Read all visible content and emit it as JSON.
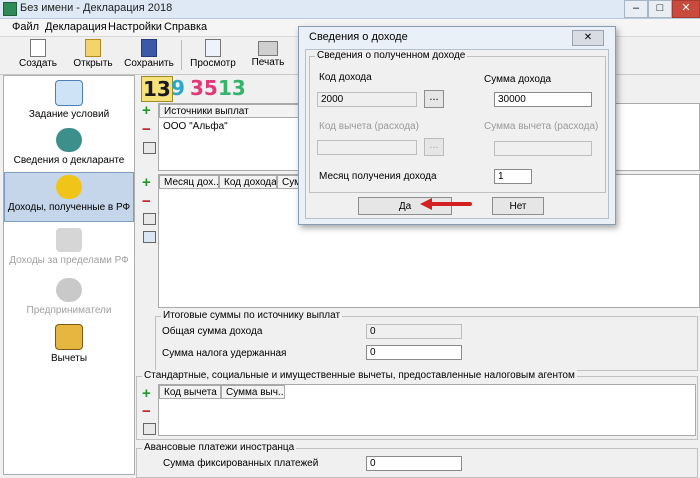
{
  "window": {
    "title": "Без имени - Декларация 2018",
    "min": "–",
    "max": "□",
    "close": "✕"
  },
  "menu": [
    "Файл",
    "Декларация",
    "Настройки",
    "Справка"
  ],
  "toolbar": {
    "create": "Создать",
    "open": "Открыть",
    "save": "Сохранить",
    "preview": "Просмотр",
    "print": "Печать"
  },
  "nav": [
    {
      "label": "Задание условий",
      "icon": "network-tree-icon"
    },
    {
      "label": "Сведения о декларанте",
      "icon": "person-icon"
    },
    {
      "label": "Доходы, полученные в РФ",
      "icon": "coins-icon"
    },
    {
      "label": "Доходы за пределами РФ",
      "icon": "money-bag-icon"
    },
    {
      "label": "Предприниматели",
      "icon": "businessman-icon"
    },
    {
      "label": "Вычеты",
      "icon": "deductions-icon"
    }
  ],
  "rates": [
    "13",
    "9",
    "35",
    "13"
  ],
  "sources": {
    "header": "Источники выплат",
    "rows": [
      "ООО \"Альфа\""
    ]
  },
  "income_table": {
    "headers": [
      "Месяц дох...",
      "Код дохода",
      "Сум"
    ]
  },
  "totals": {
    "title": "Итоговые суммы по источнику выплат",
    "income_label": "Общая сумма дохода",
    "income_value": "0",
    "tax_label": "Сумма налога удержанная",
    "tax_value": "0"
  },
  "deductions": {
    "title": "Стандартные, социальные и имущественные вычеты, предоставленные налоговым агентом",
    "headers": [
      "Код вычета",
      "Сумма выч..."
    ]
  },
  "advance": {
    "title": "Авансовые платежи иностранца",
    "label": "Сумма фиксированных платежей",
    "value": "0"
  },
  "dialog": {
    "title": "Сведения о доходе",
    "close": "✕",
    "group": "Сведения о полученном доходе",
    "income_code_label": "Код дохода",
    "income_code": "2000",
    "income_sum_label": "Сумма дохода",
    "income_sum": "30000",
    "deduction_code_label": "Код вычета (расхода)",
    "deduction_sum_label": "Сумма вычета (расхода)",
    "month_label": "Месяц получения дохода",
    "month": "1",
    "dots": "...",
    "yes": "Да",
    "no": "Нет"
  },
  "colors": {
    "plus": "#1e9a2a",
    "minus": "#c32020",
    "arrow": "#d42020",
    "selected": "#c6d6ea"
  }
}
